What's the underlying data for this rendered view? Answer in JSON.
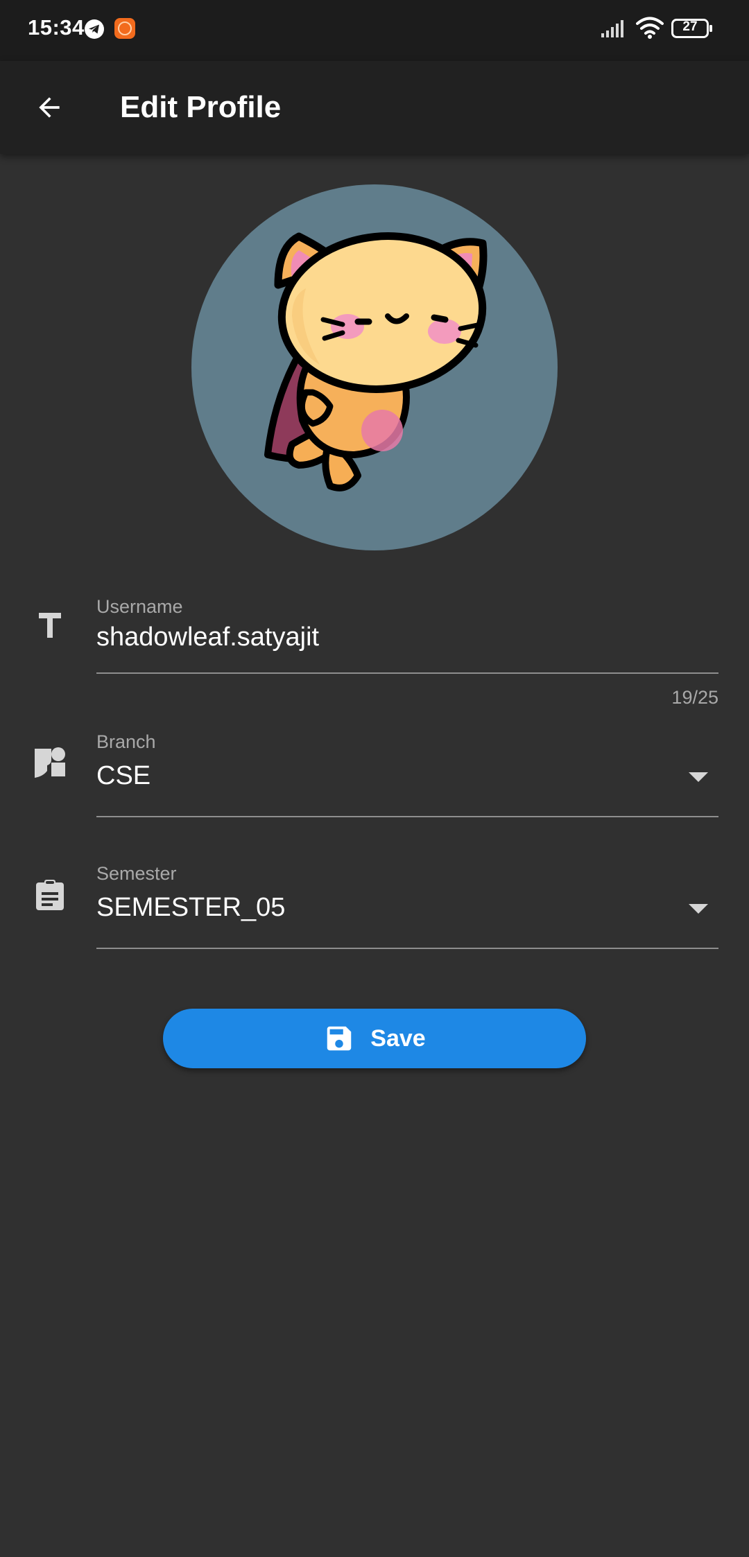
{
  "status_bar": {
    "time": "15:34",
    "battery": "27",
    "app_notif_badge": "ON",
    "icons": [
      "telegram-icon",
      "app-notification-icon",
      "signal-icon",
      "wifi-icon",
      "battery-icon"
    ]
  },
  "app_bar": {
    "title": "Edit Profile",
    "back_icon": "arrow-back-icon"
  },
  "avatar": {
    "background": "#607d8b",
    "illustration": "cat-superhero"
  },
  "form": {
    "username": {
      "label": "Username",
      "value": "shadowleaf.satyajit",
      "counter": "19/25",
      "icon": "text-fields-icon"
    },
    "branch": {
      "label": "Branch",
      "value": "CSE",
      "icon": "category-icon"
    },
    "semester": {
      "label": "Semester",
      "value": "SEMESTER_05",
      "icon": "assignment-icon"
    }
  },
  "save_button": {
    "label": "Save",
    "icon": "save-icon",
    "color": "#1e88e5"
  },
  "colors": {
    "background": "#303030",
    "app_bar": "#212121",
    "status_bar": "#1c1c1c",
    "accent": "#1e88e5"
  }
}
